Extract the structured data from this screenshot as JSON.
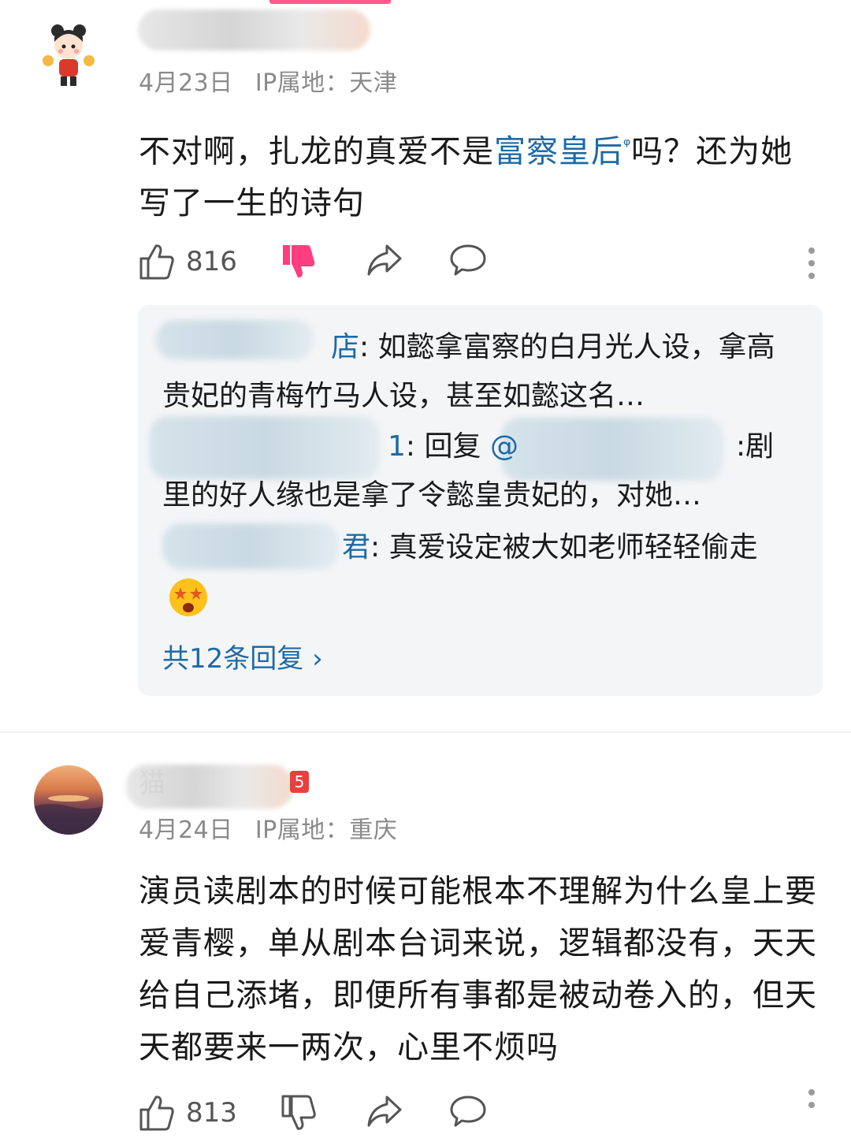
{
  "comments": [
    {
      "date": "4月23日",
      "ip": "IP属地：天津",
      "content_before": "不对啊，扎龙的真爱不是",
      "content_link": "富察皇后",
      "content_after": "吗？还为她写了一生的诗句",
      "likes": "816",
      "replies": [
        {
          "name": "店",
          "text": ": 如懿拿富察的白月光人设，拿高贵妃的青梅竹马人设，甚至如懿这名…"
        },
        {
          "name": "1",
          "text": ": 回复 ",
          "mention": "@",
          "text2": ":剧里的好人缘也是拿了令懿皇贵妃的，对她…"
        },
        {
          "name": "君",
          "text": ": 真爱设定被大如老师轻轻偷走"
        }
      ],
      "more_replies": "共12条回复 ›"
    },
    {
      "username": "猫",
      "badge": "5",
      "date": "4月24日",
      "ip": "IP属地：重庆",
      "content": "演员读剧本的时候可能根本不理解为什么皇上要爱青樱，单从剧本台词来说，逻辑都没有，天天给自己添堵，即便所有事都是被动卷入的，但天天都要来一两次，心里不烦吗",
      "likes": "813"
    }
  ],
  "colors": {
    "link": "#1e6aa6",
    "dislike_active": "#ff3d7f",
    "meta": "#8a8a8a",
    "reply_bg": "#f4f5f7"
  },
  "icons": [
    "thumbs-up-icon",
    "thumbs-down-icon",
    "share-icon",
    "comment-icon",
    "more-icon",
    "chevron-right-icon"
  ]
}
